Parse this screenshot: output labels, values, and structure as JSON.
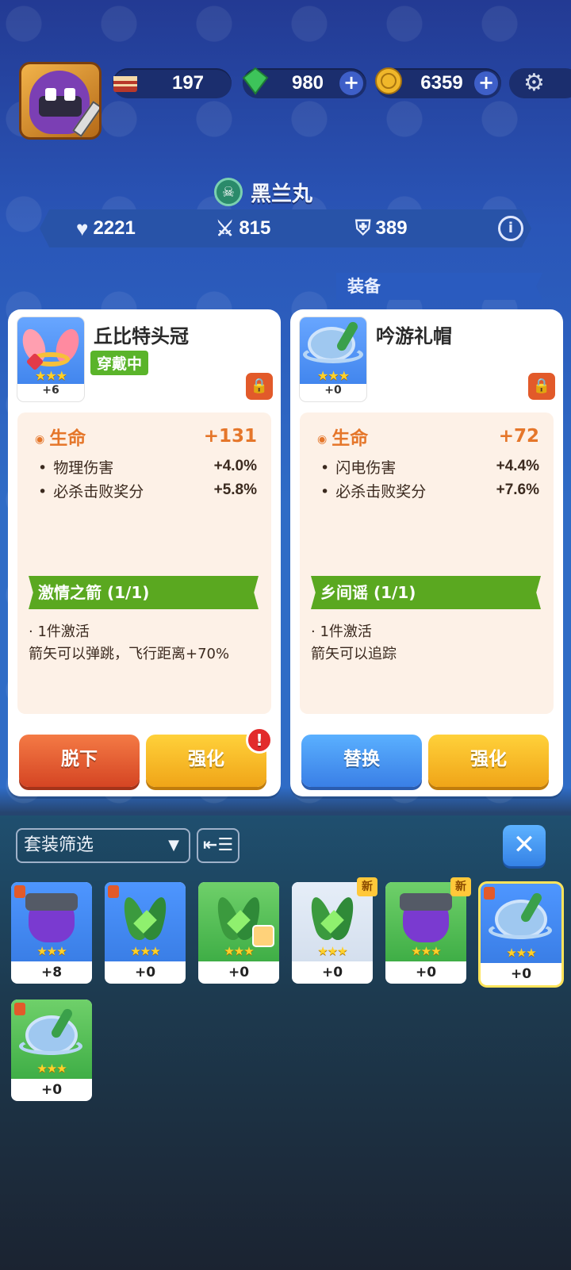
{
  "resources": {
    "tickets": "197",
    "gems": "980",
    "coins": "6359",
    "plus": "+"
  },
  "hero": {
    "name": "黑兰丸",
    "stats": {
      "health": "2221",
      "attack": "815",
      "defense": "389"
    }
  },
  "section_label": "装备",
  "equipped": {
    "title": "丘比特头冠",
    "badge": "穿戴中",
    "level": "+6",
    "stars": "★★★",
    "main_attr": {
      "label": "生命",
      "value": "+131"
    },
    "attrs": [
      {
        "label": "物理伤害",
        "value": "+4.0%"
      },
      {
        "label": "必杀击败奖分",
        "value": "+5.8%"
      }
    ],
    "set_name": "激情之箭 (1/1)",
    "set_lines": [
      "· 1件激活",
      "箭矢可以弹跳，飞行距离+70%"
    ],
    "btn_remove": "脱下",
    "btn_upgrade": "强化",
    "alert": "!"
  },
  "candidate": {
    "title": "吟游礼帽",
    "level": "+0",
    "stars": "★★★",
    "main_attr": {
      "label": "生命",
      "value": "+72"
    },
    "attrs": [
      {
        "label": "闪电伤害",
        "value": "+4.4%"
      },
      {
        "label": "必杀击败奖分",
        "value": "+7.6%"
      }
    ],
    "set_name": "乡间谣 (1/1)",
    "set_lines": [
      "· 1件激活",
      "箭矢可以追踪"
    ],
    "btn_replace": "替换",
    "btn_upgrade": "强化"
  },
  "filter": {
    "label": "套装筛选",
    "caret": "▼",
    "sort_icon": "⇤☰",
    "close_icon": "✕"
  },
  "inventory": [
    {
      "level": "+8",
      "stars": "★★★",
      "type": "purple-helmet",
      "bg": "blue",
      "locked": true
    },
    {
      "level": "+0",
      "stars": "★★★",
      "type": "leaf-crown",
      "bg": "blue",
      "locked": true
    },
    {
      "level": "+0",
      "stars": "★★★",
      "type": "leaf-crown",
      "bg": "green",
      "locked": false,
      "avatar": true
    },
    {
      "level": "+0",
      "stars": "★★★",
      "type": "leaf-crown",
      "bg": "pale",
      "locked": false,
      "new": "新"
    },
    {
      "level": "+0",
      "stars": "★★★",
      "type": "purple-helmet",
      "bg": "green",
      "locked": false,
      "new": "新"
    },
    {
      "level": "+0",
      "stars": "★★★",
      "type": "bard-hat",
      "bg": "blue",
      "locked": true,
      "selected": true
    },
    {
      "level": "+0",
      "stars": "★★★",
      "type": "bard-hat",
      "bg": "green",
      "locked": true
    }
  ]
}
